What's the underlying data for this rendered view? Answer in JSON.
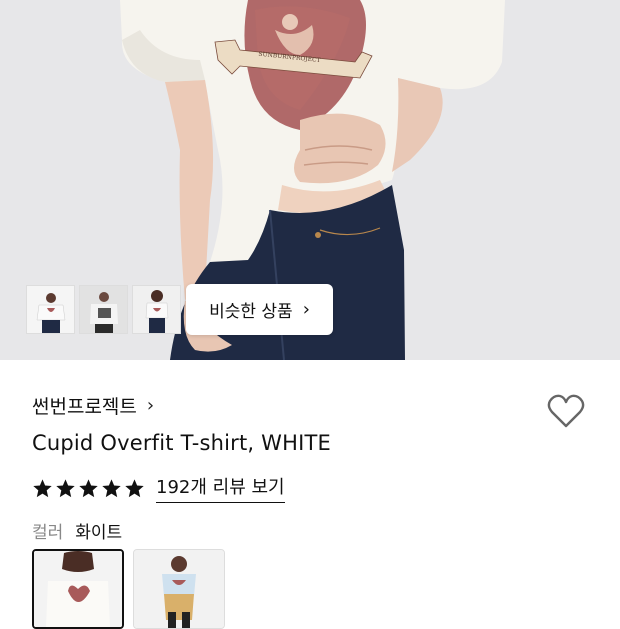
{
  "gallery": {
    "similar_button_label": "비슷한 상품",
    "similar_button_chevron": "›",
    "thumbnails": [
      "thumb-front-white",
      "thumb-gray-print",
      "thumb-side-view"
    ],
    "print_text": "SUNBURNPROJECT"
  },
  "product": {
    "brand": "썬번프로젝트",
    "brand_chevron": "›",
    "name": "Cupid Overfit T-shirt, WHITE",
    "rating_stars": 5,
    "review_link": "192개 리뷰 보기",
    "color_label": "컬러",
    "color_value": "화이트",
    "color_options": [
      "white-option",
      "alt-option"
    ]
  },
  "colors": {
    "background": "#ffffff",
    "hero_background": "#e7e7e9",
    "text": "#111111",
    "muted": "#888888",
    "tee": "#f6f4ee",
    "heart_print": "#a85a5a",
    "denim": "#1f2a44"
  }
}
